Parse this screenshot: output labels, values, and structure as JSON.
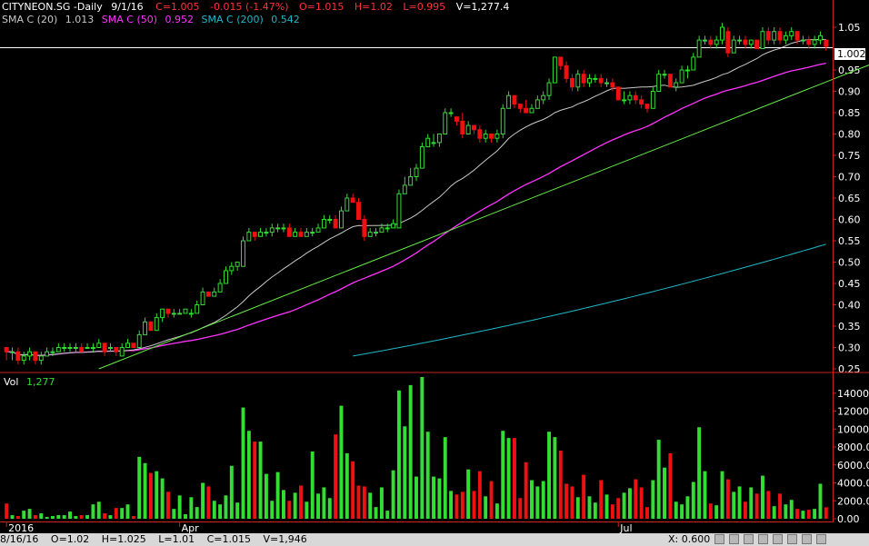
{
  "header": {
    "title": "CITYNEON.SG -Daily",
    "date": "9/1/16",
    "close": "C=1.005",
    "change": "-0.015 (-1.47%)",
    "open": "O=1.015",
    "high": "H=1.02",
    "low": "L=0.995",
    "volume": "V=1,277.4"
  },
  "indicators": [
    {
      "label": "SMA C (20)",
      "value": "1.013",
      "color": "#c8c8c8"
    },
    {
      "label": "SMA C (50)",
      "value": "0.952",
      "color": "#ff33ff"
    },
    {
      "label": "SMA C (200)",
      "value": "0.542",
      "color": "#1fb7c8"
    }
  ],
  "volume_panel": {
    "label": "Vol",
    "value": "1,277"
  },
  "last_price_tag": "1.002",
  "status_bar": {
    "date": "8/16/16",
    "open": "O=1.02",
    "high": "H=1.025",
    "low": "L=1.01",
    "close": "C=1.015",
    "volume": "V=1,946",
    "xy": "X: 0.600"
  },
  "colors": {
    "up": "#33dd33",
    "down": "#ee1111",
    "trendline": "#66ee44",
    "price_line": "#ffffff",
    "axis": "#cc2222"
  },
  "chart_data": {
    "type": "candlestick",
    "price_ylim": [
      0.25,
      1.05
    ],
    "price_ticks": [
      0.25,
      0.3,
      0.35,
      0.4,
      0.45,
      0.5,
      0.55,
      0.6,
      0.65,
      0.7,
      0.75,
      0.8,
      0.85,
      0.9,
      0.95,
      1.0,
      1.05
    ],
    "price_tick_labels": [
      "0.25",
      "0.30",
      "0.35",
      "0.40",
      "0.45",
      "0.50",
      "0.55",
      "0.60",
      "0.65",
      "0.70",
      "0.75",
      "0.80",
      "0.85",
      "0.90",
      "0.95",
      "",
      "1.05"
    ],
    "volume_ylim": [
      0,
      16000
    ],
    "volume_ticks": [
      0,
      2000,
      4000,
      6000,
      8000,
      10000,
      12000,
      14000
    ],
    "volume_tick_labels": [
      "0.00",
      "2000.00",
      "4000.00",
      "6000.00",
      "8000.00",
      "10000.00",
      "12000.00",
      "14000.00"
    ],
    "x_labels": [
      {
        "bar": 0,
        "text": "2016"
      },
      {
        "bar": 30,
        "text": "Apr"
      },
      {
        "bar": 106,
        "text": "Jul"
      }
    ],
    "horizontal_line": 1.002,
    "trendline": [
      [
        16,
        0.25
      ],
      [
        166,
        1.05
      ]
    ],
    "candles": [
      [
        0.3,
        0.29,
        0.3,
        0.27,
        1700
      ],
      [
        0.29,
        0.29,
        0.3,
        0.27,
        400
      ],
      [
        0.29,
        0.27,
        0.3,
        0.26,
        300
      ],
      [
        0.27,
        0.28,
        0.29,
        0.26,
        900
      ],
      [
        0.28,
        0.29,
        0.3,
        0.27,
        1100
      ],
      [
        0.29,
        0.27,
        0.29,
        0.26,
        400
      ],
      [
        0.27,
        0.28,
        0.29,
        0.26,
        600
      ],
      [
        0.28,
        0.29,
        0.3,
        0.28,
        200
      ],
      [
        0.29,
        0.29,
        0.3,
        0.28,
        300
      ],
      [
        0.29,
        0.3,
        0.31,
        0.29,
        400
      ],
      [
        0.3,
        0.3,
        0.31,
        0.29,
        400
      ],
      [
        0.3,
        0.3,
        0.31,
        0.29,
        800
      ],
      [
        0.3,
        0.3,
        0.31,
        0.29,
        300
      ],
      [
        0.3,
        0.29,
        0.31,
        0.29,
        400
      ],
      [
        0.3,
        0.3,
        0.31,
        0.3,
        400
      ],
      [
        0.3,
        0.3,
        0.31,
        0.29,
        1600
      ],
      [
        0.3,
        0.31,
        0.32,
        0.3,
        1900
      ],
      [
        0.31,
        0.29,
        0.31,
        0.28,
        600
      ],
      [
        0.3,
        0.3,
        0.31,
        0.29,
        400
      ],
      [
        0.3,
        0.29,
        0.3,
        0.28,
        1200
      ],
      [
        0.28,
        0.3,
        0.31,
        0.28,
        1200
      ],
      [
        0.3,
        0.31,
        0.32,
        0.3,
        1600
      ],
      [
        0.31,
        0.3,
        0.31,
        0.3,
        300
      ],
      [
        0.3,
        0.33,
        0.34,
        0.3,
        6900
      ],
      [
        0.33,
        0.36,
        0.37,
        0.33,
        6200
      ],
      [
        0.36,
        0.34,
        0.36,
        0.34,
        5100
      ],
      [
        0.34,
        0.37,
        0.38,
        0.34,
        5300
      ],
      [
        0.37,
        0.39,
        0.39,
        0.36,
        4500
      ],
      [
        0.39,
        0.38,
        0.39,
        0.37,
        3000
      ],
      [
        0.38,
        0.38,
        0.39,
        0.37,
        1100
      ],
      [
        0.38,
        0.38,
        0.39,
        0.38,
        2600
      ],
      [
        0.38,
        0.39,
        0.39,
        0.38,
        500
      ],
      [
        0.38,
        0.38,
        0.39,
        0.37,
        2400
      ],
      [
        0.38,
        0.4,
        0.41,
        0.38,
        1300
      ],
      [
        0.4,
        0.43,
        0.44,
        0.4,
        4000
      ],
      [
        0.43,
        0.42,
        0.43,
        0.42,
        3600
      ],
      [
        0.42,
        0.43,
        0.44,
        0.42,
        2000
      ],
      [
        0.43,
        0.45,
        0.46,
        0.43,
        1600
      ],
      [
        0.45,
        0.48,
        0.49,
        0.45,
        2600
      ],
      [
        0.48,
        0.49,
        0.5,
        0.47,
        5900
      ],
      [
        0.49,
        0.5,
        0.5,
        0.48,
        1800
      ],
      [
        0.49,
        0.55,
        0.56,
        0.49,
        12400
      ],
      [
        0.55,
        0.57,
        0.58,
        0.55,
        9800
      ],
      [
        0.57,
        0.56,
        0.57,
        0.55,
        8600
      ],
      [
        0.56,
        0.57,
        0.58,
        0.56,
        8600
      ],
      [
        0.57,
        0.57,
        0.58,
        0.56,
        5000
      ],
      [
        0.57,
        0.58,
        0.59,
        0.56,
        2000
      ],
      [
        0.58,
        0.58,
        0.59,
        0.57,
        5200
      ],
      [
        0.58,
        0.58,
        0.59,
        0.57,
        3200
      ],
      [
        0.58,
        0.56,
        0.59,
        0.56,
        2000
      ],
      [
        0.56,
        0.57,
        0.58,
        0.56,
        2900
      ],
      [
        0.57,
        0.56,
        0.58,
        0.56,
        3700
      ],
      [
        0.56,
        0.57,
        0.58,
        0.56,
        1900
      ],
      [
        0.57,
        0.57,
        0.58,
        0.56,
        7500
      ],
      [
        0.57,
        0.58,
        0.59,
        0.57,
        2800
      ],
      [
        0.58,
        0.6,
        0.61,
        0.58,
        3500
      ],
      [
        0.6,
        0.6,
        0.61,
        0.59,
        2300
      ],
      [
        0.6,
        0.58,
        0.61,
        0.58,
        9400
      ],
      [
        0.58,
        0.62,
        0.63,
        0.58,
        12600
      ],
      [
        0.62,
        0.65,
        0.66,
        0.62,
        7300
      ],
      [
        0.65,
        0.64,
        0.66,
        0.64,
        6400
      ],
      [
        0.64,
        0.6,
        0.65,
        0.6,
        3700
      ],
      [
        0.6,
        0.56,
        0.61,
        0.55,
        3600
      ],
      [
        0.56,
        0.57,
        0.58,
        0.56,
        2900
      ],
      [
        0.57,
        0.57,
        0.58,
        0.56,
        1300
      ],
      [
        0.57,
        0.58,
        0.59,
        0.57,
        3500
      ],
      [
        0.58,
        0.58,
        0.59,
        0.57,
        900
      ],
      [
        0.58,
        0.59,
        0.6,
        0.58,
        5400
      ],
      [
        0.58,
        0.66,
        0.67,
        0.58,
        14300
      ],
      [
        0.66,
        0.68,
        0.7,
        0.66,
        10300
      ],
      [
        0.68,
        0.7,
        0.72,
        0.68,
        14900
      ],
      [
        0.7,
        0.72,
        0.73,
        0.69,
        4700
      ],
      [
        0.72,
        0.77,
        0.78,
        0.72,
        15800
      ],
      [
        0.77,
        0.79,
        0.8,
        0.77,
        9700
      ],
      [
        0.78,
        0.78,
        0.8,
        0.77,
        4700
      ],
      [
        0.78,
        0.8,
        0.8,
        0.77,
        4500
      ],
      [
        0.8,
        0.85,
        0.86,
        0.8,
        9100
      ],
      [
        0.85,
        0.85,
        0.86,
        0.84,
        3100
      ],
      [
        0.84,
        0.83,
        0.84,
        0.82,
        2700
      ],
      [
        0.83,
        0.8,
        0.85,
        0.79,
        3000
      ],
      [
        0.8,
        0.82,
        0.83,
        0.8,
        5500
      ],
      [
        0.82,
        0.81,
        0.82,
        0.8,
        3100
      ],
      [
        0.81,
        0.79,
        0.82,
        0.78,
        5300
      ],
      [
        0.79,
        0.8,
        0.81,
        0.78,
        2500
      ],
      [
        0.8,
        0.79,
        0.8,
        0.78,
        4200
      ],
      [
        0.79,
        0.8,
        0.81,
        0.78,
        1700
      ],
      [
        0.8,
        0.86,
        0.87,
        0.79,
        9800
      ],
      [
        0.86,
        0.89,
        0.9,
        0.86,
        9000
      ],
      [
        0.89,
        0.87,
        0.89,
        0.86,
        9000
      ],
      [
        0.87,
        0.86,
        0.87,
        0.85,
        2300
      ],
      [
        0.86,
        0.85,
        0.88,
        0.85,
        6300
      ],
      [
        0.85,
        0.86,
        0.87,
        0.85,
        4300
      ],
      [
        0.86,
        0.88,
        0.89,
        0.86,
        3600
      ],
      [
        0.88,
        0.89,
        0.9,
        0.87,
        4200
      ],
      [
        0.89,
        0.92,
        0.93,
        0.88,
        9700
      ],
      [
        0.92,
        0.98,
        0.98,
        0.92,
        9100
      ],
      [
        0.98,
        0.96,
        0.98,
        0.95,
        7600
      ],
      [
        0.96,
        0.93,
        0.97,
        0.92,
        3900
      ],
      [
        0.93,
        0.91,
        0.94,
        0.9,
        3600
      ],
      [
        0.91,
        0.94,
        0.95,
        0.9,
        2400
      ],
      [
        0.94,
        0.92,
        0.95,
        0.91,
        4900
      ],
      [
        0.92,
        0.93,
        0.94,
        0.91,
        2500
      ],
      [
        0.93,
        0.93,
        0.94,
        0.92,
        1800
      ],
      [
        0.93,
        0.92,
        0.94,
        0.91,
        4300
      ],
      [
        0.92,
        0.92,
        0.93,
        0.91,
        2700
      ],
      [
        0.92,
        0.91,
        0.93,
        0.9,
        1600
      ],
      [
        0.91,
        0.88,
        0.91,
        0.88,
        2300
      ],
      [
        0.88,
        0.88,
        0.9,
        0.87,
        2900
      ],
      [
        0.88,
        0.89,
        0.9,
        0.87,
        3400
      ],
      [
        0.89,
        0.88,
        0.9,
        0.87,
        4400
      ],
      [
        0.88,
        0.87,
        0.89,
        0.86,
        3500
      ],
      [
        0.87,
        0.86,
        0.87,
        0.85,
        1300
      ],
      [
        0.86,
        0.9,
        0.91,
        0.86,
        4300
      ],
      [
        0.9,
        0.94,
        0.95,
        0.9,
        8800
      ],
      [
        0.94,
        0.94,
        0.95,
        0.93,
        5700
      ],
      [
        0.94,
        0.91,
        0.94,
        0.91,
        7300
      ],
      [
        0.91,
        0.92,
        0.93,
        0.9,
        1900
      ],
      [
        0.92,
        0.95,
        0.96,
        0.92,
        1600
      ],
      [
        0.95,
        0.95,
        0.96,
        0.93,
        2500
      ],
      [
        0.95,
        0.98,
        0.99,
        0.95,
        4100
      ],
      [
        0.98,
        1.02,
        1.03,
        0.98,
        10200
      ],
      [
        1.02,
        1.02,
        1.03,
        1.01,
        5300
      ],
      [
        1.02,
        1.01,
        1.03,
        1.0,
        1700
      ],
      [
        1.01,
        1.02,
        1.03,
        1.0,
        1500
      ],
      [
        1.02,
        1.05,
        1.06,
        1.01,
        5300
      ],
      [
        1.04,
        0.99,
        1.05,
        0.98,
        4400
      ],
      [
        0.99,
        1.02,
        1.03,
        0.99,
        3000
      ],
      [
        1.02,
        1.02,
        1.03,
        1.01,
        3600
      ],
      [
        1.02,
        1.01,
        1.03,
        1.0,
        1900
      ],
      [
        1.01,
        1.02,
        1.02,
        1.0,
        3500
      ],
      [
        1.02,
        1.0,
        1.02,
        1.0,
        2800
      ],
      [
        1.0,
        1.04,
        1.05,
        1.0,
        4800
      ],
      [
        1.04,
        1.02,
        1.05,
        1.01,
        3100
      ],
      [
        1.02,
        1.04,
        1.05,
        1.01,
        1400
      ],
      [
        1.04,
        1.02,
        1.05,
        1.01,
        2800
      ],
      [
        1.02,
        1.03,
        1.04,
        1.01,
        1600
      ],
      [
        1.03,
        1.04,
        1.05,
        1.02,
        2100
      ],
      [
        1.04,
        1.02,
        1.04,
        1.01,
        1100
      ],
      [
        1.02,
        1.02,
        1.03,
        1.01,
        900
      ],
      [
        1.02,
        1.01,
        1.03,
        1.0,
        1000
      ],
      [
        1.01,
        1.02,
        1.03,
        1.0,
        1100
      ],
      [
        1.02,
        1.03,
        1.04,
        1.01,
        3900
      ],
      [
        1.02,
        1.005,
        1.02,
        0.995,
        1277
      ]
    ]
  }
}
